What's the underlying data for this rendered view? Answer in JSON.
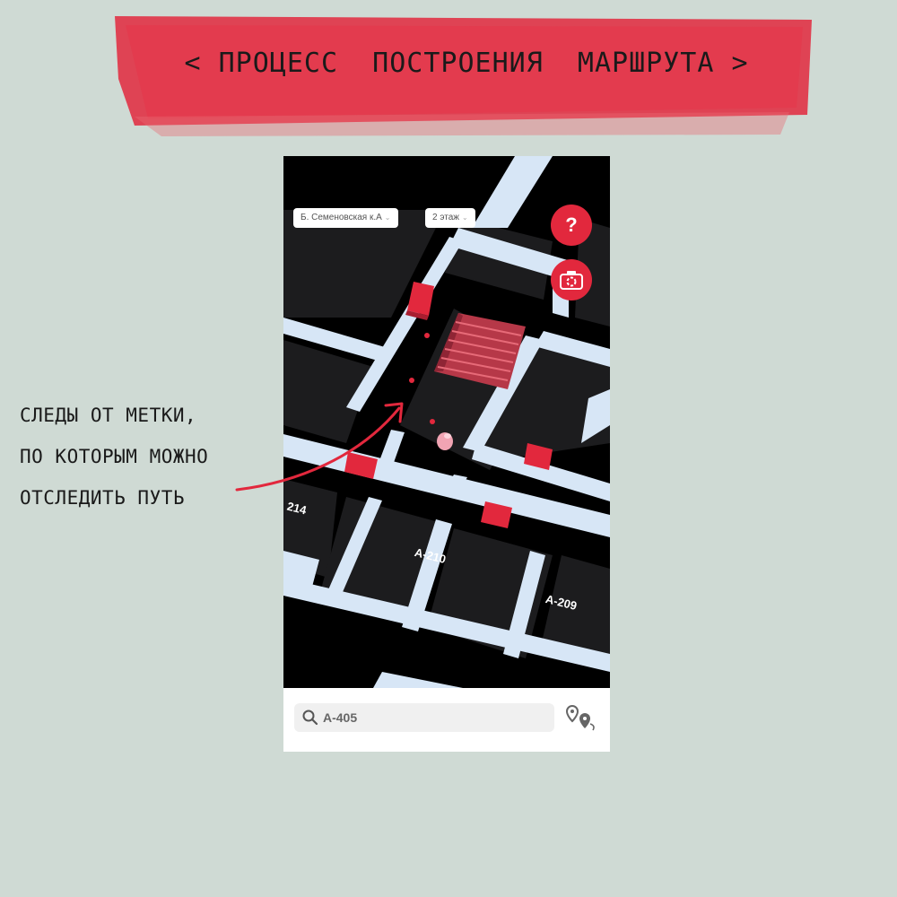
{
  "banner": {
    "title": "< ПРОЦЕСС  ПОСТРОЕНИЯ  МАРШРУТА >",
    "color": "#e2283d"
  },
  "app": {
    "location_selector": "Б. Семеновская к.А",
    "floor_selector": "2 этаж",
    "help_button": "?",
    "camera_button_icon": "camera-icon",
    "rooms": [
      "214",
      "А-210",
      "А-209"
    ],
    "search": {
      "value": "А-405",
      "icon": "search-icon"
    },
    "route_button_icon": "route-pins-icon",
    "accent": "#e2283d"
  },
  "annotation": {
    "lines": [
      "СЛЕДЫ ОТ МЕТКИ,",
      "ПО КОТОРЫМ МОЖНО",
      "ОТСЛЕДИТЬ ПУТЬ"
    ]
  }
}
